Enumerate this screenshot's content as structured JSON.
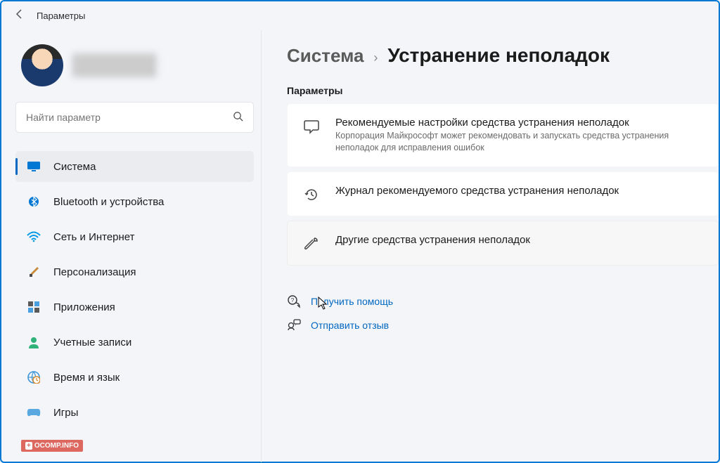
{
  "titlebar": {
    "title": "Параметры"
  },
  "search": {
    "placeholder": "Найти параметр"
  },
  "sidebar": {
    "items": [
      {
        "label": "Система",
        "icon": "🖥️",
        "active": true
      },
      {
        "label": "Bluetooth и устройства",
        "icon": "bt",
        "active": false
      },
      {
        "label": "Сеть и Интернет",
        "icon": "wifi",
        "active": false
      },
      {
        "label": "Персонализация",
        "icon": "brush",
        "active": false
      },
      {
        "label": "Приложения",
        "icon": "apps",
        "active": false
      },
      {
        "label": "Учетные записи",
        "icon": "user",
        "active": false
      },
      {
        "label": "Время и язык",
        "icon": "globe",
        "active": false
      },
      {
        "label": "Игры",
        "icon": "game",
        "active": false
      }
    ]
  },
  "breadcrumb": {
    "parent": "Система",
    "current": "Устранение неполадок"
  },
  "section_label": "Параметры",
  "cards": [
    {
      "title": "Рекомендуемые настройки средства устранения неполадок",
      "desc": "Корпорация Майкрософт может рекомендовать и запускать средства устранения неполадок для исправления ошибок"
    },
    {
      "title": "Журнал рекомендуемого средства устранения неполадок",
      "desc": ""
    },
    {
      "title": "Другие средства устранения неполадок",
      "desc": ""
    }
  ],
  "links": [
    {
      "label": "Получить помощь"
    },
    {
      "label": "Отправить отзыв"
    }
  ],
  "watermark": "OCOMP.INFO"
}
